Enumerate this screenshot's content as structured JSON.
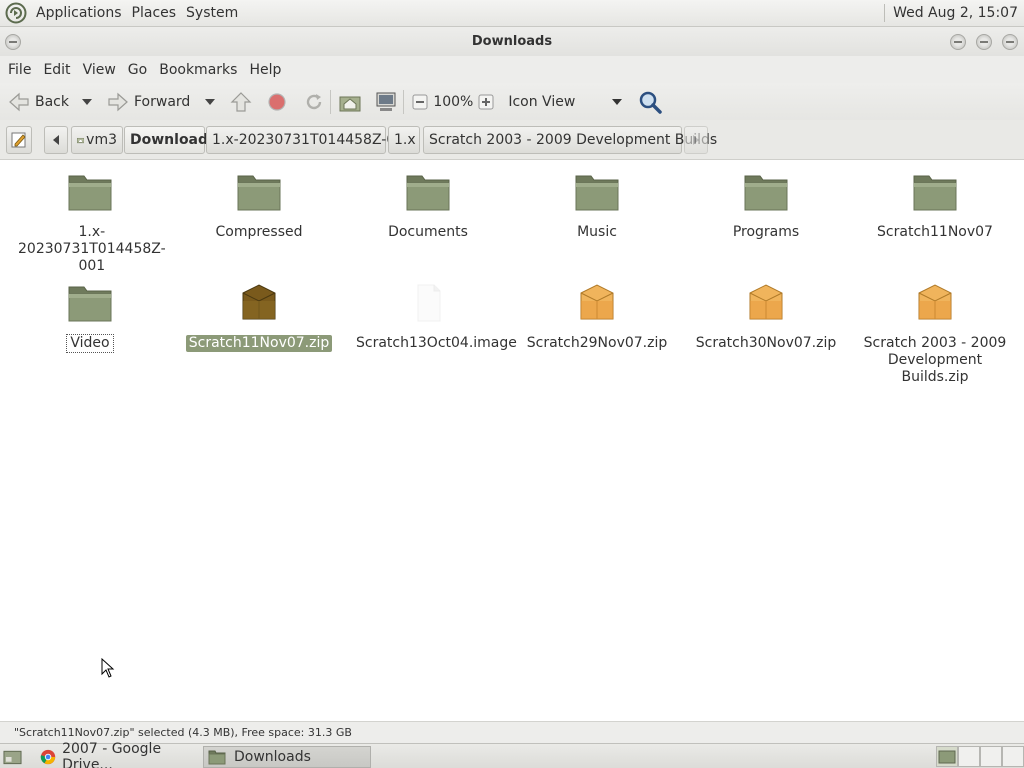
{
  "top_panel": {
    "menus": [
      "Applications",
      "Places",
      "System"
    ],
    "clock": "Wed Aug  2, 15:07"
  },
  "window": {
    "title": "Downloads"
  },
  "menubar": [
    "File",
    "Edit",
    "View",
    "Go",
    "Bookmarks",
    "Help"
  ],
  "toolbar": {
    "back_label": "Back",
    "forward_label": "Forward",
    "zoom_level": "100%",
    "view_mode": "Icon View"
  },
  "breadcrumbs": [
    "vm3",
    "Downloads",
    "1.x-20230731T014458Z-001",
    "1.x",
    "Scratch 2003 - 2009 Development Builds"
  ],
  "files": [
    {
      "name": "1.x-20230731T014458Z-001",
      "type": "folder"
    },
    {
      "name": "Compressed",
      "type": "folder"
    },
    {
      "name": "Documents",
      "type": "folder"
    },
    {
      "name": "Music",
      "type": "folder"
    },
    {
      "name": "Programs",
      "type": "folder"
    },
    {
      "name": "Scratch11Nov07",
      "type": "folder"
    },
    {
      "name": "Video",
      "type": "folder"
    },
    {
      "name": "Scratch11Nov07.zip",
      "type": "archive-selected"
    },
    {
      "name": "Scratch13Oct04.image",
      "type": "file"
    },
    {
      "name": "Scratch29Nov07.zip",
      "type": "archive"
    },
    {
      "name": "Scratch30Nov07.zip",
      "type": "archive"
    },
    {
      "name": "Scratch 2003 - 2009 Development Builds.zip",
      "type": "archive"
    }
  ],
  "status": "\"Scratch11Nov07.zip\" selected (4.3 MB), Free space: 31.3 GB",
  "taskbar": [
    {
      "label": "2007 - Google Drive..."
    },
    {
      "label": "Downloads"
    }
  ],
  "colors": {
    "selection": "#8c9a78",
    "folder": "#8c9a78",
    "archive": "#e8a84a"
  }
}
